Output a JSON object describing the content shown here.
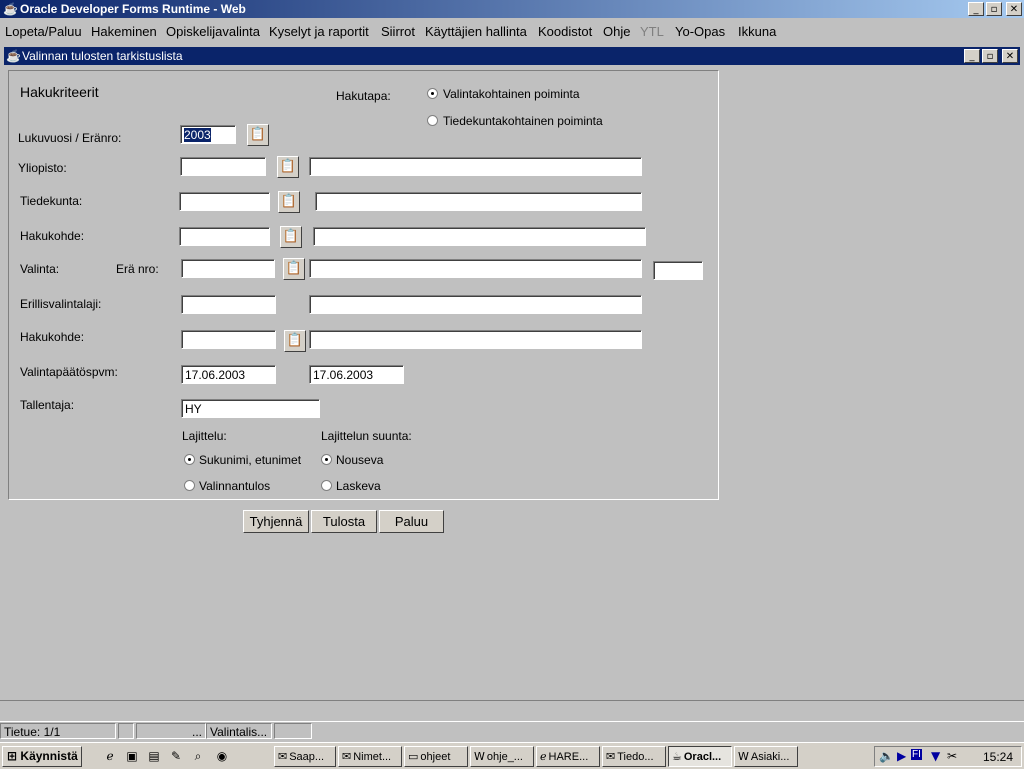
{
  "window": {
    "title": "Oracle Developer Forms Runtime - Web",
    "min_label": "_",
    "max_label": "▫",
    "close_label": "✕"
  },
  "menu": [
    {
      "label": "Lopeta/Paluu",
      "enabled": true
    },
    {
      "label": "Hakeminen",
      "enabled": true
    },
    {
      "label": "Opiskelijavalinta",
      "enabled": true
    },
    {
      "label": "Kyselyt ja raportit",
      "enabled": true
    },
    {
      "label": "Siirrot",
      "enabled": true
    },
    {
      "label": "Käyttäjien hallinta",
      "enabled": true
    },
    {
      "label": "Koodistot",
      "enabled": true
    },
    {
      "label": "Ohje",
      "enabled": true
    },
    {
      "label": "YTL",
      "enabled": false
    },
    {
      "label": "Yo-Opas",
      "enabled": true
    },
    {
      "label": "Ikkuna",
      "enabled": true
    }
  ],
  "inner_window": {
    "title": "Valinnan tulosten tarkistuslista"
  },
  "form": {
    "header": "Hakukriteerit",
    "hakutapa": {
      "label": "Hakutapa:",
      "options": [
        {
          "label": "Valintakohtainen poiminta",
          "selected": true
        },
        {
          "label": "Tiedekuntakohtainen poiminta",
          "selected": false
        }
      ]
    },
    "lukuvuosi": {
      "label": "Lukuvuosi / Eränro:",
      "value": "2003"
    },
    "yliopisto": {
      "label": "Yliopisto:",
      "code": "",
      "name": ""
    },
    "tiedekunta": {
      "label": "Tiedekunta:",
      "code": "",
      "name": ""
    },
    "hakukohde1": {
      "label": "Hakukohde:",
      "code": "",
      "name": ""
    },
    "valinta": {
      "label": "Valinta:",
      "era_label": "Erä nro:",
      "code": "",
      "name": "",
      "era": ""
    },
    "erillisvalintalaji": {
      "label": "Erillisvalintalaji:",
      "code": "",
      "name": ""
    },
    "hakukohde2": {
      "label": "Hakukohde:",
      "code": "",
      "name": ""
    },
    "valintapaatospvm": {
      "label": "Valintapäätöspvm:",
      "from": "17.06.2003",
      "to": "17.06.2003"
    },
    "tallentaja": {
      "label": "Tallentaja:",
      "value": "HY"
    },
    "lajittelu": {
      "label": "Lajittelu:",
      "options": [
        {
          "label": "Sukunimi, etunimet",
          "selected": true
        },
        {
          "label": "Valinnantulos",
          "selected": false
        }
      ]
    },
    "suunta": {
      "label": "Lajittelun suunta:",
      "options": [
        {
          "label": "Nouseva",
          "selected": true
        },
        {
          "label": "Laskeva",
          "selected": false
        }
      ]
    }
  },
  "buttons": {
    "clear": "Tyhjennä",
    "print": "Tulosta",
    "back": "Paluu"
  },
  "status": {
    "record": "Tietue: 1/1",
    "cell3": "...",
    "cell4": "Valintalis..."
  },
  "taskbar": {
    "start": "Käynnistä",
    "tasks": [
      {
        "label": "Saap...",
        "icon": "chat-icon"
      },
      {
        "label": "Nimet...",
        "icon": "mail-icon"
      },
      {
        "label": "ohjeet",
        "icon": "folder-icon"
      },
      {
        "label": "ohje_...",
        "icon": "word-icon"
      },
      {
        "label": "HARE...",
        "icon": "browser-icon"
      },
      {
        "label": "Tiedo...",
        "icon": "mail-icon"
      },
      {
        "label": "Oracl...",
        "icon": "java-icon",
        "active": true
      },
      {
        "label": "Asiaki...",
        "icon": "word-icon"
      }
    ],
    "clock": "15:24",
    "lang": "FI"
  }
}
